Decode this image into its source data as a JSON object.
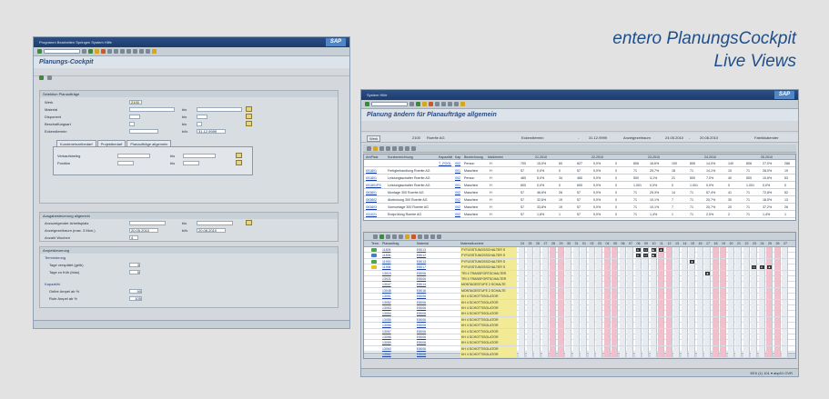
{
  "slide_title": {
    "line1": "entero PlanungsCockpit",
    "line2": "Live Views"
  },
  "window1": {
    "menu": "Programm  Bearbeiten  Springen  System  Hilfe",
    "logo": "SAP",
    "title": "Planungs-Cockpit",
    "selection": {
      "header": "Selektion Planaufträge",
      "werk_label": "Werk",
      "werk_value": "2100",
      "material_label": "Material",
      "disponent_label": "Disponent",
      "beschaffungsart_label": "Beschaffungsart",
      "eckendtermin_label": "Eckendtermin",
      "bis": "bis",
      "bis2": "b/is",
      "date_to": "31.12.9999",
      "tabs": [
        "Kundeneinzelbedarf",
        "Projektbedarf",
        "Planaufträge allgemein"
      ],
      "verkaufsbeleg_label": "Verkaufsbeleg",
      "position_label": "Position"
    },
    "ausgabe": {
      "header": "Ausgabesteuerung allgemein",
      "arbeitsplatz_label": "Anzuzeigender Arbeitsplatz",
      "zeitraum_label": "Anzeigezeitraum (max. 3 Mon.)",
      "date_from": "20.05.2010",
      "date_to": "20.08.2010",
      "wochen_label": "Anzahl Wochen",
      "wochen_value": "4"
    },
    "ampel": {
      "header": "Ampelsteuerung",
      "termin_header": "Terminierung",
      "verspaetet_label": "Tage verspätet (gelb)",
      "verspaetet_value": "3",
      "frueh_label": "Tage zu früh (blau)",
      "frueh_value": "5",
      "kap_header": "Kapazität",
      "gelb_label": "Gelbe Ampel ab %",
      "gelb_value": "90",
      "rot_label": "Rote Ampel ab %",
      "rot_value": "105"
    }
  },
  "window2": {
    "menu": "System  Hilfe",
    "logo": "SAP",
    "title": "Planung ändern für Planaufträge allgemein",
    "infobar": {
      "werk_label": "Werk",
      "werk_value": "2100",
      "werk_name": "Roerite AG",
      "eckendtermin": "Eckendtermin",
      "dash": "-",
      "date_to": "31.12.9999",
      "zeitraum_label": "Anzeigezeitraum",
      "from": "24.05.2010",
      "to": "20.08.2010",
      "fabrik": "Fabrikkalender"
    },
    "cap_headers": [
      "ArbPlatz",
      "Kurzbezeichnung",
      "Kapazität",
      "Kap",
      "Bezeichnung",
      "Maßeinhei"
    ],
    "weeks_top": [
      "21.2010",
      "22.2010",
      "23.2010",
      "24.2010",
      "25.2010"
    ],
    "cap_rows": [
      {
        "arb": "",
        "kurz": "",
        "kap": "T_POOL",
        "k": "002",
        "bez": "Person",
        "me": "H",
        "v1": "700",
        "p1": "15,0%",
        "a1": "60",
        "v2": "827",
        "p2": "0,0%",
        "a2": "0",
        "v3": "806",
        "p3": "16,6%",
        "a3": "100",
        "v4": "806",
        "p4": "14,0%",
        "a4": "140",
        "v5": "806",
        "p5": "27,0%",
        "a5": "286"
      },
      {
        "arb": "001801",
        "kurz": "Fertigbehandlung Roerite AG",
        "kap": "",
        "k": "001",
        "bez": "Maschine",
        "me": "H",
        "v1": "57",
        "p1": "0,0%",
        "a1": "0",
        "v2": "57",
        "p2": "0,0%",
        "a2": "0",
        "v3": "71",
        "p3": "25,7%",
        "a3": "18",
        "v4": "71",
        "p4": "14,1%",
        "a4": "10",
        "v5": "71",
        "p5": "28,0%",
        "a5": "19"
      },
      {
        "arb": "001801",
        "kurz": "Leistungsschalter Roerite AG",
        "kap": "",
        "k": "002",
        "bez": "Person",
        "me": "H",
        "v1": "460",
        "p1": "5,0%",
        "a1": "34",
        "v2": "460",
        "p2": "0,0%",
        "a2": "0",
        "v3": "500",
        "p3": "4,1%",
        "a3": "21",
        "v4": "500",
        "p4": "7,0%",
        "a4": "40",
        "v5": "500",
        "p5": "10,6%",
        "a5": "53"
      },
      {
        "arb": "001801PS",
        "kurz": "Leistungsschalter Roerite AG",
        "kap": "",
        "k": "001",
        "bez": "Maschine",
        "me": "H",
        "v1": "600",
        "p1": "0,0%",
        "a1": "0",
        "v2": "600",
        "p2": "0,0%",
        "a2": "0",
        "v3": "1.001",
        "p3": "0,0%",
        "a3": "0",
        "v4": "1.001",
        "p4": "0,0%",
        "a4": "0",
        "v5": "1.001",
        "p5": "0,0%",
        "a5": "0"
      },
      {
        "arb": "063801",
        "kurz": "Montage 300 Roerite AG",
        "kap": "",
        "k": "002",
        "bez": "Maschine",
        "me": "H",
        "v1": "57",
        "p1": "46,6%",
        "a1": "26",
        "v2": "57",
        "p2": "0,0%",
        "a2": "0",
        "v3": "71",
        "p3": "25,3%",
        "a3": "14",
        "v4": "71",
        "p4": "57,4%",
        "a4": "41",
        "v5": "71",
        "p5": "72,8%",
        "a5": "52"
      },
      {
        "arb": "063802",
        "kurz": "Abdeckung 300 Roerite AG",
        "kap": "",
        "k": "002",
        "bez": "Maschine",
        "me": "H",
        "v1": "57",
        "p1": "32,6%",
        "a1": "19",
        "v2": "57",
        "p2": "0,0%",
        "a2": "0",
        "v3": "71",
        "p3": "10,1%",
        "a3": "7",
        "v4": "71",
        "p4": "20,7%",
        "a4": "30",
        "v5": "71",
        "p5": "18,5%",
        "a5": "13"
      },
      {
        "arb": "063803",
        "kurz": "Vormontage 300 Roerite AG",
        "kap": "",
        "k": "002",
        "bez": "Maschine",
        "me": "H",
        "v1": "57",
        "p1": "33,8%",
        "a1": "19",
        "v2": "57",
        "p2": "0,0%",
        "a2": "0",
        "v3": "71",
        "p3": "10,1%",
        "a3": "7",
        "v4": "71",
        "p4": "20,7%",
        "a4": "20",
        "v5": "71",
        "p5": "37,2%",
        "a5": "26"
      },
      {
        "arb": "031021",
        "kurz": "Endprüfung Roerite AG",
        "kap": "",
        "k": "002",
        "bez": "Maschine",
        "me": "H",
        "v1": "57",
        "p1": "1,8%",
        "a1": "1",
        "v2": "57",
        "p2": "0,0%",
        "a2": "0",
        "v3": "71",
        "p3": "1,4%",
        "a3": "1",
        "v4": "71",
        "p4": "2,0%",
        "a4": "2",
        "v5": "71",
        "p5": "1,4%",
        "a5": "1"
      }
    ],
    "order_headers": [
      "Term.",
      "Planauftrag",
      "Material",
      "Materialkurztext"
    ],
    "day_headers": [
      "24",
      "25",
      "26",
      "27",
      "28",
      "29",
      "30",
      "31",
      "01",
      "02",
      "03",
      "04",
      "05",
      "06",
      "07",
      "08",
      "09",
      "10",
      "11",
      "12",
      "13",
      "14",
      "15",
      "16",
      "17",
      "18",
      "19",
      "20",
      "21",
      "22",
      "23",
      "24",
      "25",
      "26",
      "27"
    ],
    "orders": [
      {
        "pa": "11805",
        "mat": "E8013",
        "txt": "FYFLEISTUNGSSCHALTER S",
        "icon": "green"
      },
      {
        "pa": "11806",
        "mat": "E8012",
        "txt": "FYFLEISTUNGSSCHALTER S",
        "icon": "blue"
      },
      {
        "pa": "11900",
        "mat": "E8013",
        "txt": "FYFLEISTUNGSSCHALTER S",
        "icon": "green"
      },
      {
        "pa": "11906",
        "mat": "E8017",
        "txt": "FYFLEISTUNGSSCHALTER S",
        "icon": "yellow"
      },
      {
        "pa": "13019",
        "mat": "E8006",
        "txt": "TRI 4 TRANSFORTSCHALTER",
        "icon": ""
      },
      {
        "pa": "13021",
        "mat": "E8006",
        "txt": "TRI 4 TRANSFORTSCHALTER",
        "icon": ""
      },
      {
        "pa": "13047",
        "mat": "E8014",
        "txt": "MONTAGESTUFE 2 SCHALTE",
        "icon": ""
      },
      {
        "pa": "13048",
        "mat": "E8016",
        "txt": "MONTAGESTUFE 2 SCHALTE",
        "icon": ""
      },
      {
        "pa": "13051",
        "mat": "E8006",
        "txt": "KH 4 SCHOTTISOLATOR",
        "icon": ""
      },
      {
        "pa": "13052",
        "mat": "E8006",
        "txt": "KH 4 SCHOTTISOLATOR",
        "icon": ""
      },
      {
        "pa": "13053",
        "mat": "E8006",
        "txt": "KH 4 SCHOTTISOLATOR",
        "icon": ""
      },
      {
        "pa": "13054",
        "mat": "E8006",
        "txt": "KH 4 SCHOTTISOLATOR",
        "icon": ""
      },
      {
        "pa": "13055",
        "mat": "E8006",
        "txt": "KH 4 SCHOTTISOLATOR",
        "icon": ""
      },
      {
        "pa": "13056",
        "mat": "E8006",
        "txt": "KH 4 SCHOTTISOLATOR",
        "icon": ""
      },
      {
        "pa": "13057",
        "mat": "E8006",
        "txt": "KH 4 SCHOTTISOLATOR",
        "icon": ""
      },
      {
        "pa": "13058",
        "mat": "E8006",
        "txt": "KH 4 SCHOTTISOLATOR",
        "icon": ""
      },
      {
        "pa": "13059",
        "mat": "E8006",
        "txt": "KH 4 SCHOTTISOLATOR",
        "icon": ""
      },
      {
        "pa": "13060",
        "mat": "E8006",
        "txt": "KH 4 SCHOTTISOLATOR",
        "icon": ""
      },
      {
        "pa": "13061",
        "mat": "E8006",
        "txt": "KH 4 SCHOTTISOLATOR",
        "icon": ""
      },
      {
        "pa": "13062",
        "mat": "E8006",
        "txt": "KH 4 SCHOTTISOLATOR",
        "icon": ""
      }
    ],
    "status_right": "EE0 (1) 101  ▾  abp01  OVR"
  }
}
